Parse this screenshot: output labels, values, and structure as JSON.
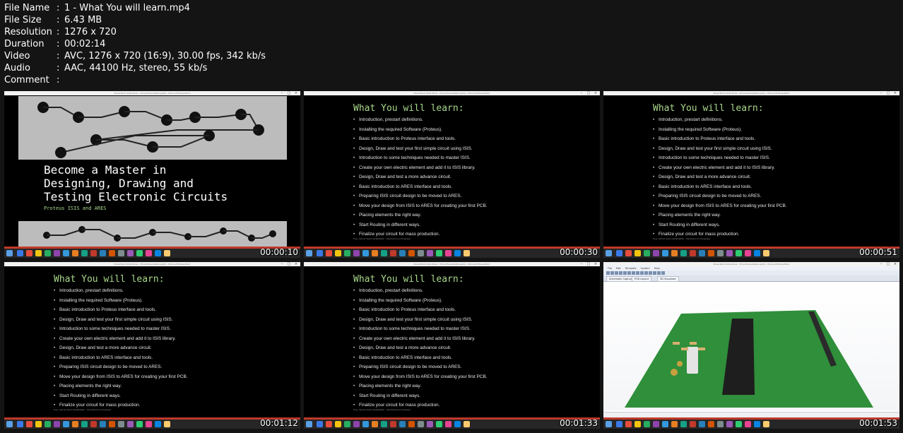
{
  "meta": [
    {
      "key": "File Name",
      "value": "1 - What You will learn.mp4"
    },
    {
      "key": "File Size",
      "value": "6.43 MB"
    },
    {
      "key": "Resolution",
      "value": "1276 x 720"
    },
    {
      "key": "Duration",
      "value": "00:02:14"
    },
    {
      "key": "Video",
      "value": "AVC, 1276 x 720 (16:9), 30.00 fps, 342 kb/s"
    },
    {
      "key": "Audio",
      "value": "AAC, 44100 Hz, stereo, 55 kb/s"
    },
    {
      "key": "Comment",
      "value": ""
    }
  ],
  "separator": ":",
  "window_title": "PowerPoint Slide Show - [Final Presentation.pptx] - Microsoft PowerPoint",
  "title_slide": {
    "title_lines": [
      "Become a Master in",
      "Designing, Drawing and",
      "Testing Electronic Circuits"
    ],
    "subtitle": "Proteus ISIS and ARES"
  },
  "learn_slide": {
    "title": "What You will learn:",
    "items": [
      "Introduction, prestart definitions.",
      "Installing the required Software (Proteus).",
      "Basic introduction to Proteus interface and tools.",
      "Design, Draw and test your first simple circuit using ISIS.",
      "Introduction to some techniques needed to master ISIS.",
      "Create your own electric element and add it to ISIS library.",
      "Design, Draw and test a more advance circuit.",
      "Basic introduction to ARES interface and tools.",
      "Preparing ISIS circuit design to be moved to ARES.",
      "Move your design from ISIS to ARES for creating your first PCB.",
      "Placing elements the right way.",
      "Start Routing in different ways.",
      "Finalize your circuit for mass production."
    ],
    "footer": "Eng. Ashraf Saad Abdelfattah - Mechatronics Engineer"
  },
  "pcb_window": {
    "menu": [
      "File",
      "Edit",
      "Template",
      "System",
      "Help"
    ],
    "tabs": [
      "Schematic Capture",
      "PCB Layout",
      "3D Visualizer"
    ]
  },
  "thumbnails": [
    {
      "kind": "title",
      "time": "00:00:10"
    },
    {
      "kind": "learn",
      "time": "00:00:30"
    },
    {
      "kind": "learn",
      "time": "00:00:51"
    },
    {
      "kind": "learn",
      "time": "00:01:12"
    },
    {
      "kind": "learn",
      "time": "00:01:33"
    },
    {
      "kind": "pcb",
      "time": "00:01:53"
    }
  ],
  "colors": {
    "background": "#141414",
    "slide_title": "#a8d88a",
    "taskbar_accent": "#c0392b",
    "pcb_board": "#2f8f3a"
  }
}
